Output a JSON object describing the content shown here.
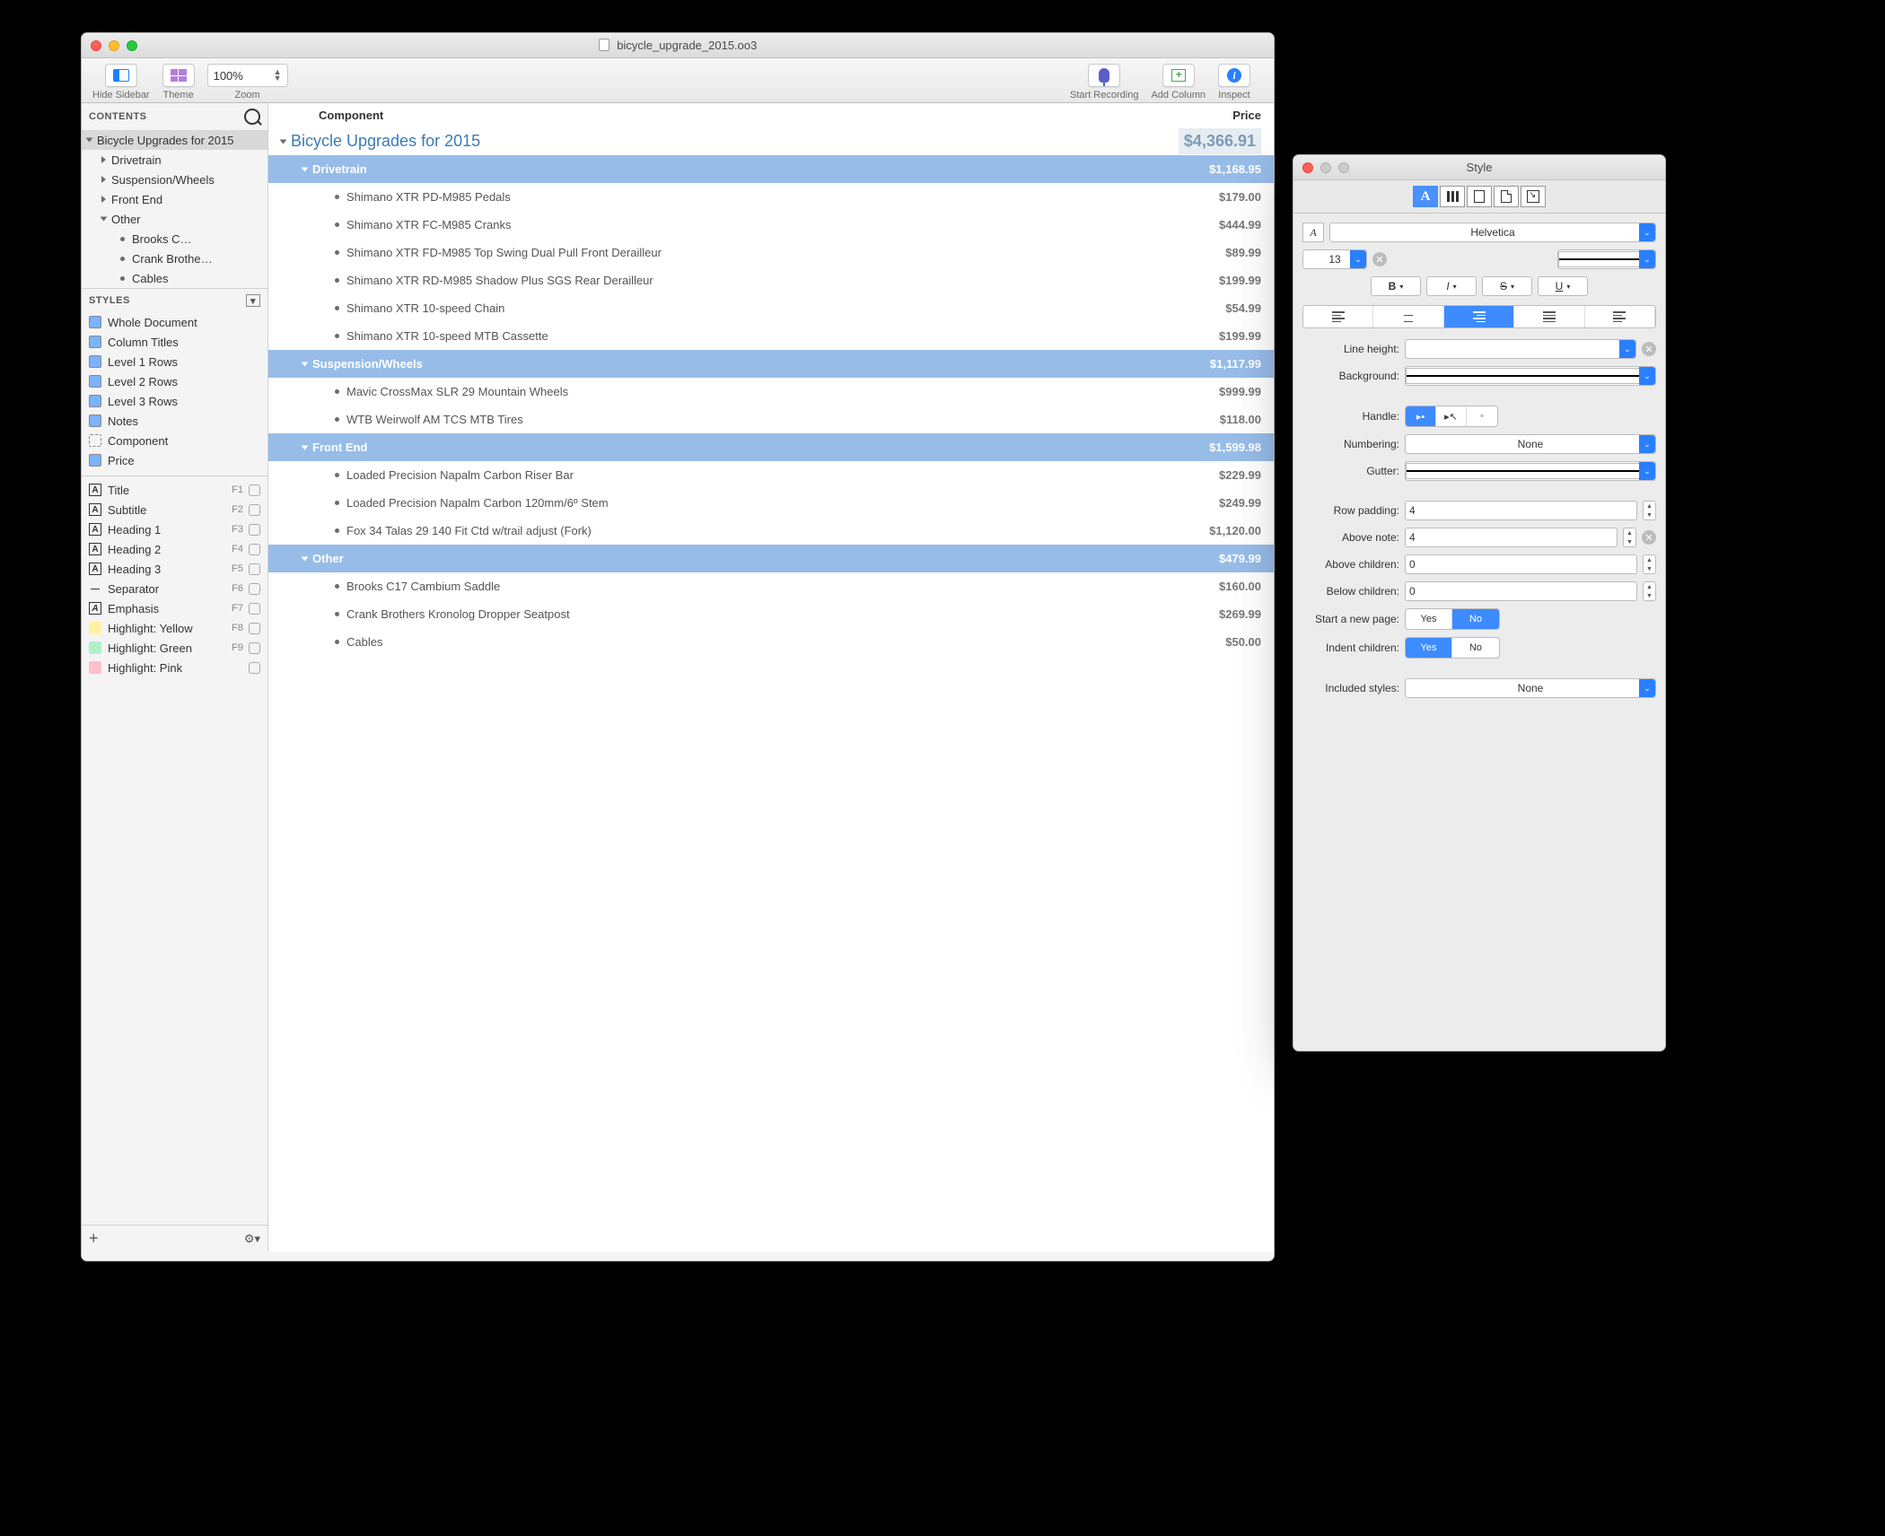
{
  "mainWindow": {
    "title": "bicycle_upgrade_2015.oo3",
    "toolbar": {
      "hideSidebar": "Hide Sidebar",
      "theme": "Theme",
      "zoom": "Zoom",
      "zoomValue": "100%",
      "startRecording": "Start Recording",
      "addColumn": "Add Column",
      "inspect": "Inspect"
    },
    "sidebar": {
      "contentsHeader": "CONTENTS",
      "stylesHeader": "STYLES",
      "tree": {
        "root": "Bicycle Upgrades for 2015",
        "items": [
          {
            "label": "Drivetrain"
          },
          {
            "label": "Suspension/Wheels"
          },
          {
            "label": "Front End"
          },
          {
            "label": "Other",
            "children": [
              "Brooks C…",
              "Crank Brothe…",
              "Cables"
            ]
          }
        ]
      },
      "styles": [
        "Whole Document",
        "Column Titles",
        "Level 1 Rows",
        "Level 2 Rows",
        "Level 3 Rows",
        "Notes",
        "Component",
        "Price"
      ],
      "namedStyles": [
        {
          "label": "Title",
          "key": "F1"
        },
        {
          "label": "Subtitle",
          "key": "F2"
        },
        {
          "label": "Heading 1",
          "key": "F3"
        },
        {
          "label": "Heading 2",
          "key": "F4"
        },
        {
          "label": "Heading 3",
          "key": "F5"
        },
        {
          "label": "Separator",
          "key": "F6"
        },
        {
          "label": "Emphasis",
          "key": "F7"
        },
        {
          "label": "Highlight: Yellow",
          "key": "F8",
          "swatch": "hl-yellow"
        },
        {
          "label": "Highlight: Green",
          "key": "F9",
          "swatch": "hl-green"
        },
        {
          "label": "Highlight: Pink",
          "key": "",
          "swatch": "hl-pink"
        }
      ]
    },
    "outline": {
      "columnComponent": "Component",
      "columnPrice": "Price",
      "rows": [
        {
          "level": 0,
          "label": "Bicycle Upgrades for 2015",
          "price": "$4,366.91"
        },
        {
          "level": 1,
          "label": "Drivetrain",
          "price": "$1,168.95"
        },
        {
          "level": 2,
          "label": "Shimano XTR PD-M985 Pedals",
          "price": "$179.00"
        },
        {
          "level": 2,
          "label": "Shimano XTR FC-M985 Cranks",
          "price": "$444.99"
        },
        {
          "level": 2,
          "label": "Shimano XTR FD-M985 Top Swing Dual Pull Front Derailleur",
          "price": "$89.99"
        },
        {
          "level": 2,
          "label": "Shimano XTR RD-M985 Shadow Plus SGS Rear Derailleur",
          "price": "$199.99"
        },
        {
          "level": 2,
          "label": "Shimano XTR 10-speed Chain",
          "price": "$54.99"
        },
        {
          "level": 2,
          "label": "Shimano XTR 10-speed MTB Cassette",
          "price": "$199.99"
        },
        {
          "level": 1,
          "label": "Suspension/Wheels",
          "price": "$1,117.99"
        },
        {
          "level": 2,
          "label": "Mavic CrossMax SLR 29 Mountain Wheels",
          "price": "$999.99"
        },
        {
          "level": 2,
          "label": "WTB Weirwolf AM TCS MTB Tires",
          "price": "$118.00"
        },
        {
          "level": 1,
          "label": "Front End",
          "price": "$1,599.98"
        },
        {
          "level": 2,
          "label": "Loaded Precision Napalm Carbon Riser Bar",
          "price": "$229.99"
        },
        {
          "level": 2,
          "label": "Loaded Precision Napalm Carbon 120mm/6º Stem",
          "price": "$249.99"
        },
        {
          "level": 2,
          "label": "Fox 34 Talas 29 140 Fit Ctd w/trail adjust (Fork)",
          "price": "$1,120.00"
        },
        {
          "level": 1,
          "label": "Other",
          "price": "$479.99"
        },
        {
          "level": 2,
          "label": "Brooks C17 Cambium Saddle",
          "price": "$160.00"
        },
        {
          "level": 2,
          "label": "Crank Brothers Kronolog Dropper Seatpost",
          "price": "$269.99"
        },
        {
          "level": 2,
          "label": "Cables",
          "price": "$50.00"
        }
      ]
    }
  },
  "inspector": {
    "title": "Style",
    "font": "Helvetica",
    "fontSize": "13",
    "lineHeight": "Line height:",
    "background": "Background:",
    "handle": "Handle:",
    "numbering": "Numbering:",
    "numberingValue": "None",
    "gutter": "Gutter:",
    "rowPadding": "Row padding:",
    "rowPaddingValue": "4",
    "aboveNote": "Above note:",
    "aboveNoteValue": "4",
    "aboveChildren": "Above children:",
    "aboveChildrenValue": "0",
    "belowChildren": "Below children:",
    "belowChildrenValue": "0",
    "startNewPage": "Start a new page:",
    "indentChildren": "Indent children:",
    "includedStyles": "Included styles:",
    "includedValue": "None",
    "yes": "Yes",
    "no": "No",
    "bold": "B",
    "italic": "I",
    "strike": "S",
    "underline": "U"
  }
}
